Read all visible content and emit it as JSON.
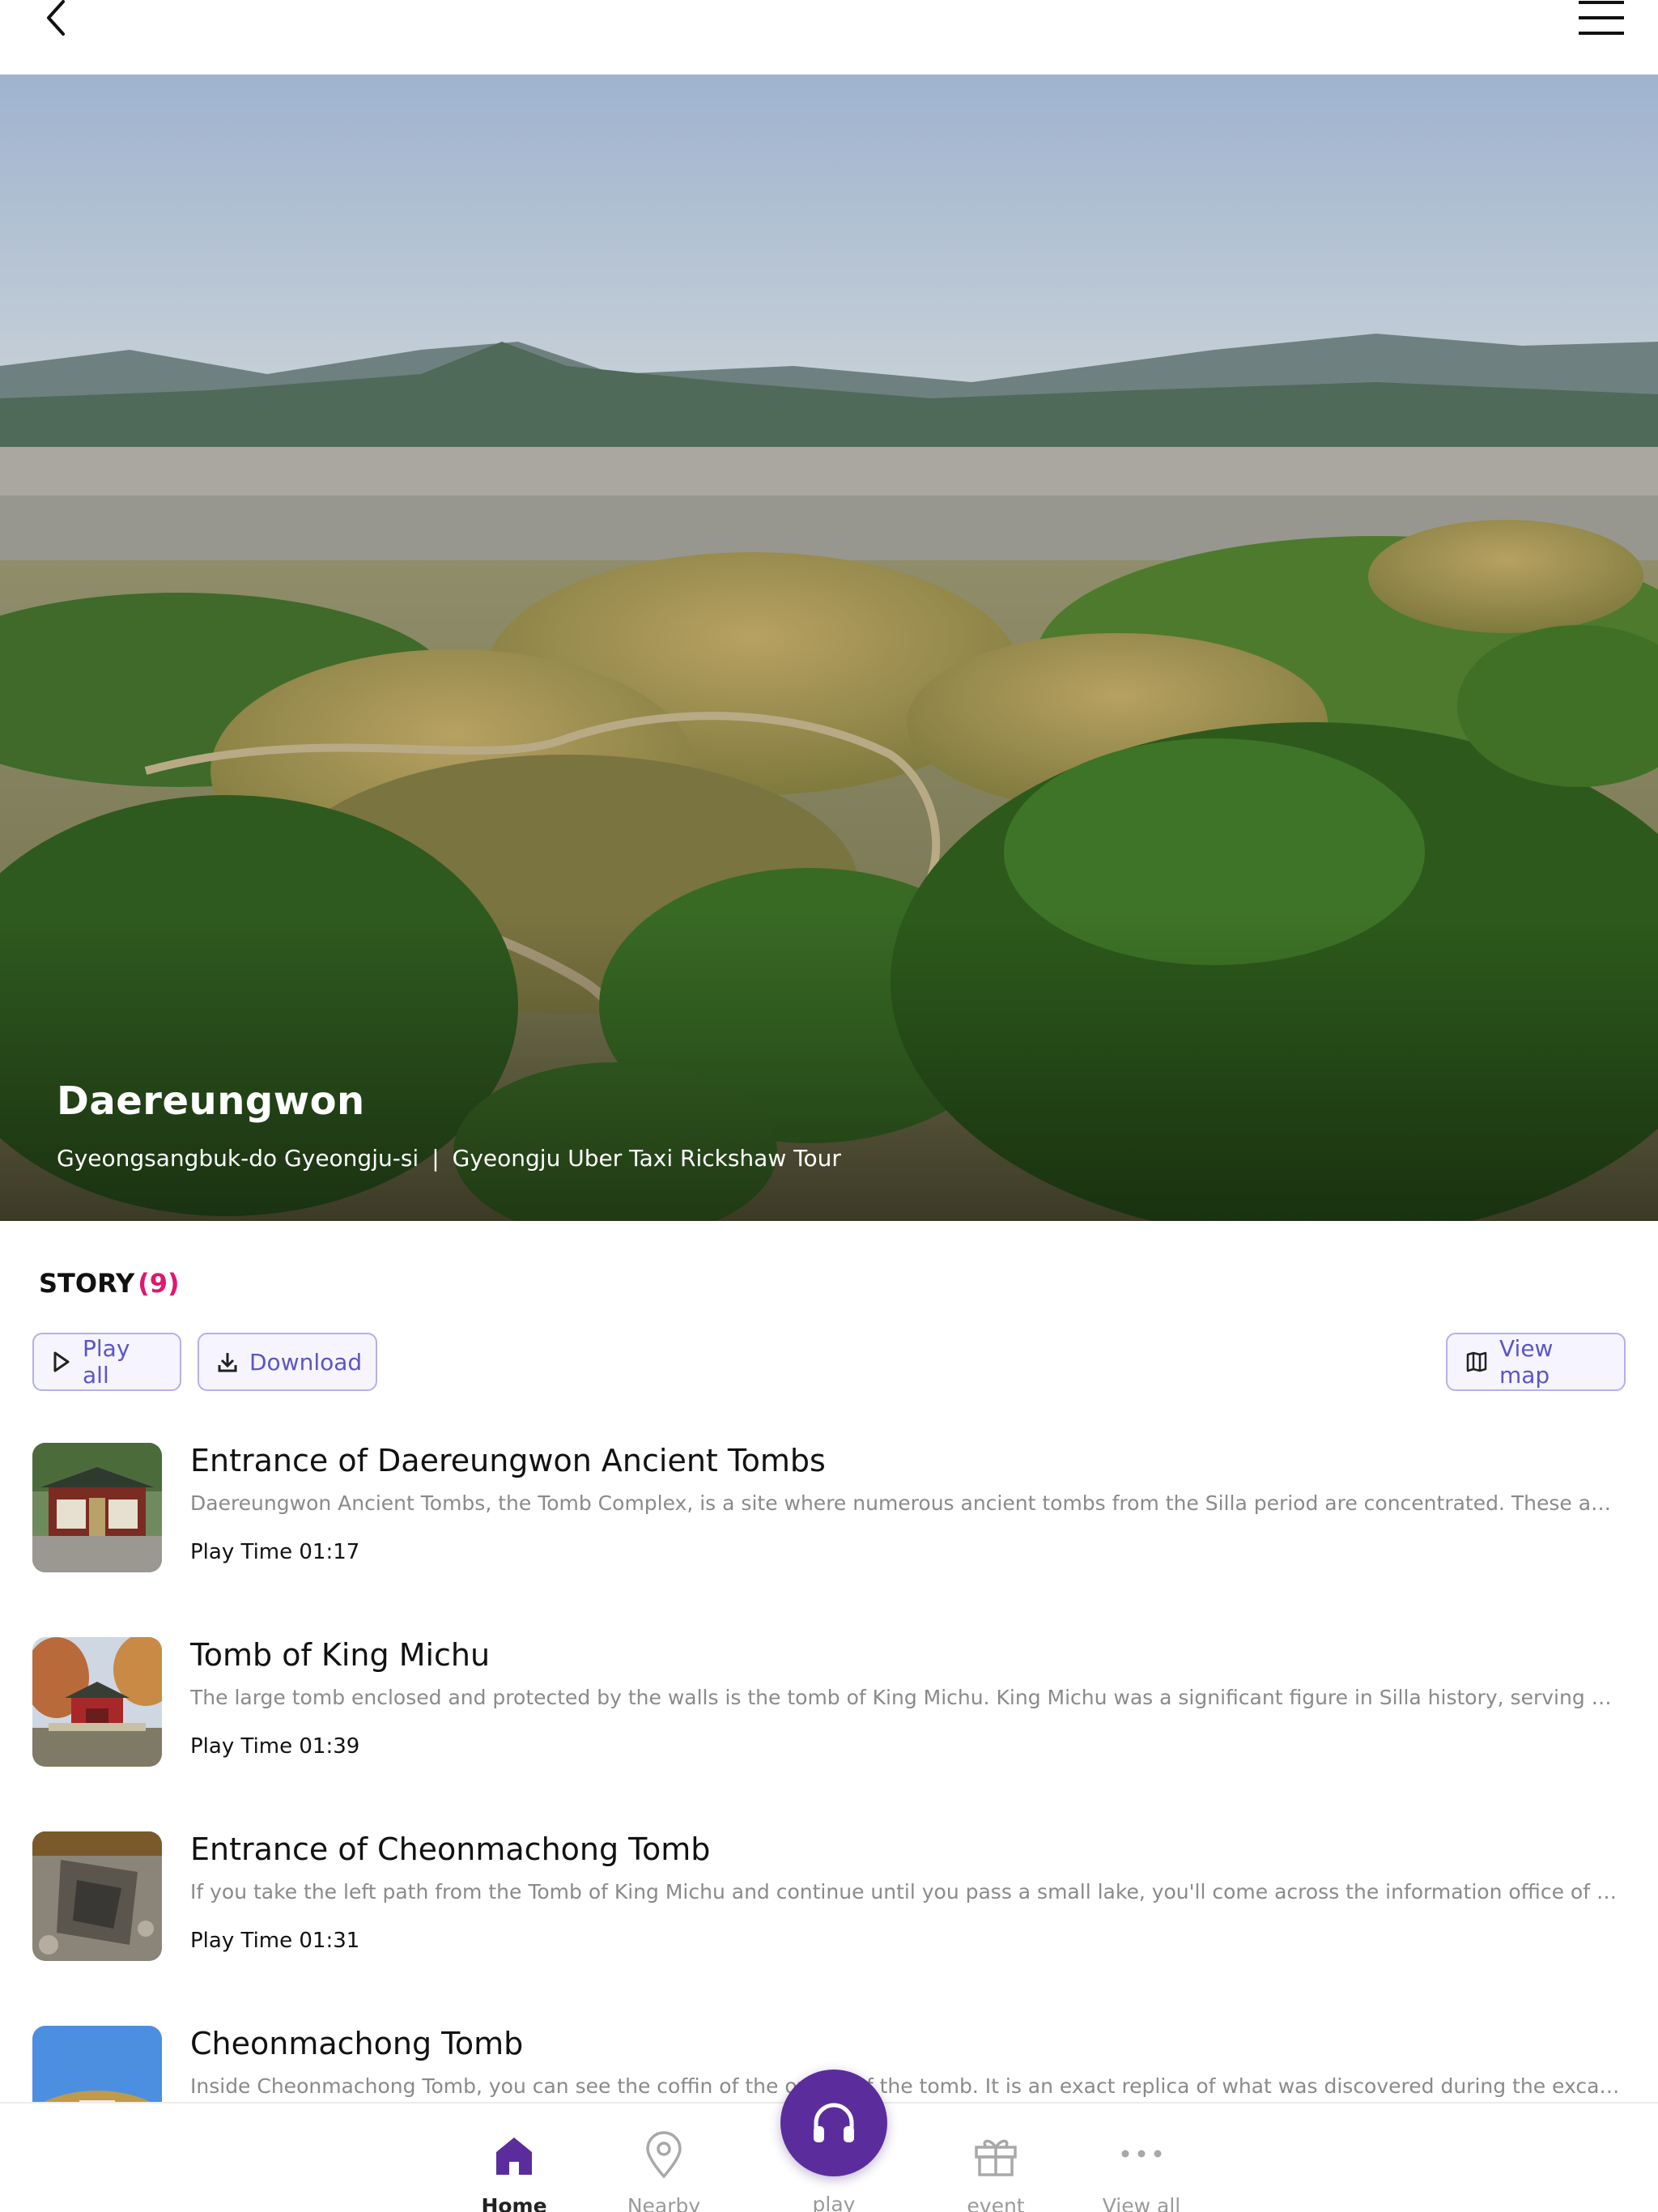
{
  "header": {
    "back_icon": "chevron-left-icon",
    "menu_icon": "hamburger-menu-icon"
  },
  "hero": {
    "title": "Daereungwon",
    "location": "Gyeongsangbuk-do Gyeongju-si",
    "separator": "|",
    "tour": "Gyeongju Uber Taxi Rickshaw Tour"
  },
  "story": {
    "label": "STORY",
    "count": "(9)",
    "actions": {
      "play_all": "Play all",
      "download": "Download",
      "view_map": "View map"
    },
    "items": [
      {
        "title": "Entrance of Daereungwon Ancient Tombs",
        "description": "Daereungwon Ancient Tombs, the Tomb Complex, is a site where numerous ancient tombs from the Silla period are concentrated. These ancient tombs a...",
        "play_time": "Play Time 01:17"
      },
      {
        "title": "Tomb of King Michu",
        "description": "The large tomb enclosed and protected by the walls is the tomb of King Michu. King Michu was a significant figure in Silla history, serving as the first Kin...",
        "play_time": "Play Time 01:39"
      },
      {
        "title": "Entrance of Cheonmachong Tomb",
        "description": "If you take the left path from the Tomb of King Michu and continue until you pass a small lake, you'll come across the information office of Cheonmacho...",
        "play_time": "Play Time 01:31"
      },
      {
        "title": "Cheonmachong Tomb",
        "description": "Inside Cheonmachong Tomb, you can see the coffin of the owner of the tomb. It is an exact replica of what was discovered during the excavation. The to...",
        "play_time": ""
      }
    ]
  },
  "nav": {
    "home": "Home",
    "nearby": "Nearby",
    "play": "play",
    "event": "event",
    "view_all": "View all"
  },
  "colors": {
    "accent": "#5b2d9c",
    "count": "#e0176e",
    "button_text": "#5a55c7",
    "button_border": "#b4b0ea"
  }
}
